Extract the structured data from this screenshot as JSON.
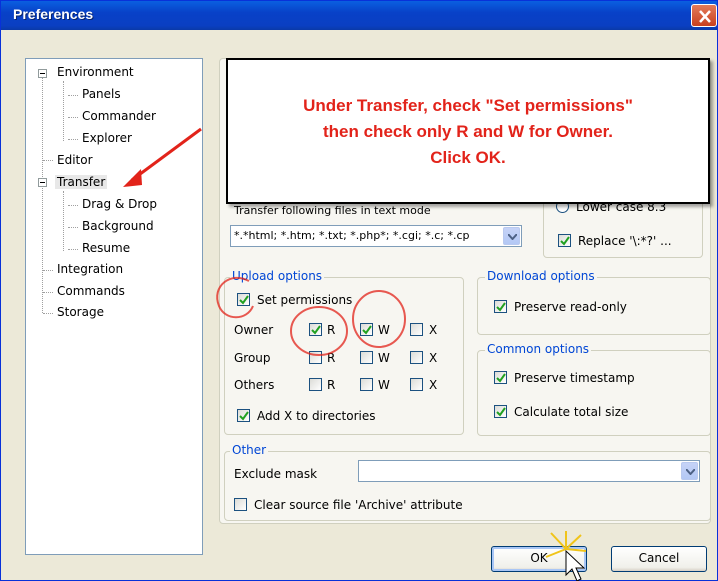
{
  "window": {
    "title": "Preferences"
  },
  "tree": {
    "items": [
      {
        "label": "Environment"
      },
      {
        "label": "Panels"
      },
      {
        "label": "Commander"
      },
      {
        "label": "Explorer"
      },
      {
        "label": "Editor"
      },
      {
        "label": "Transfer"
      },
      {
        "label": "Drag & Drop"
      },
      {
        "label": "Background"
      },
      {
        "label": "Resume"
      },
      {
        "label": "Integration"
      },
      {
        "label": "Commands"
      },
      {
        "label": "Storage"
      }
    ]
  },
  "transfer_mode": {
    "label": "Transfer following files in text mode",
    "mask": "*.*html; *.htm; *.txt; *.php*; *.cgi; *.c; *.cp",
    "lower_case": "Lower case 8.3",
    "replace": "Replace '\\:*?' ..."
  },
  "upload": {
    "title": "Upload options",
    "set_permissions": "Set permissions",
    "rows": [
      {
        "label": "Owner",
        "r": true,
        "w": true,
        "x": false
      },
      {
        "label": "Group",
        "r": false,
        "w": false,
        "x": false
      },
      {
        "label": "Others",
        "r": false,
        "w": false,
        "x": false
      }
    ],
    "col_r": "R",
    "col_w": "W",
    "col_x": "X",
    "add_x": "Add X to directories"
  },
  "download": {
    "title": "Download options",
    "preserve_readonly": "Preserve read-only"
  },
  "common": {
    "title": "Common options",
    "preserve_timestamp": "Preserve timestamp",
    "calc_size": "Calculate total size"
  },
  "other": {
    "title": "Other",
    "exclude_mask": "Exclude mask",
    "exclude_value": "",
    "clear_archive": "Clear source file 'Archive' attribute"
  },
  "buttons": {
    "ok": "OK",
    "cancel": "Cancel"
  },
  "callout": {
    "line1": "Under Transfer, check \"Set permissions\"",
    "line2": "then check only R and W for Owner.",
    "line3": "Click OK."
  },
  "colors": {
    "accent": "#0046d5",
    "annotation": "#e2231a"
  }
}
